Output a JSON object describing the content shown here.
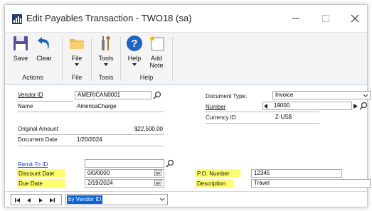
{
  "window": {
    "title": "Edit Payables Transaction  -  TWO18 (sa)"
  },
  "ribbon": {
    "groups": [
      {
        "label": "Actions",
        "buttons": [
          {
            "label": "Save",
            "icon": "save-icon"
          },
          {
            "label": "Clear",
            "icon": "undo-icon"
          }
        ]
      },
      {
        "label": "File",
        "buttons": [
          {
            "label": "File",
            "icon": "folder-icon"
          }
        ]
      },
      {
        "label": "Tools",
        "buttons": [
          {
            "label": "Tools",
            "icon": "tools-icon"
          }
        ]
      },
      {
        "label": "Help",
        "buttons": [
          {
            "label": "Help",
            "icon": "help-icon"
          },
          {
            "label": "Add",
            "label2": "Note",
            "icon": "note-icon"
          }
        ]
      }
    ]
  },
  "form": {
    "vendor_id": {
      "label": "Vendor ID",
      "value": "AMERICAN0001"
    },
    "name": {
      "label": "Name",
      "value": "AmericaCharge"
    },
    "original_amount": {
      "label": "Original Amount",
      "value": "$22,500.00"
    },
    "document_date": {
      "label": "Document Date",
      "value": "1/20/2024"
    },
    "remit_to_id": {
      "label": "Remit-To ID",
      "value": ""
    },
    "discount_date": {
      "label": "Discount Date",
      "value": "0/0/0000"
    },
    "due_date": {
      "label": "Due Date",
      "value": "2/19/2024"
    },
    "document_type": {
      "label": "Document Type:",
      "value": "Invoice"
    },
    "number": {
      "label": "Number",
      "value": "19000"
    },
    "currency_id": {
      "label": "Currency ID",
      "value": "Z-US$"
    },
    "po_number": {
      "label": "P.O. Number",
      "value": "12345"
    },
    "description": {
      "label": "Description",
      "value": "Travel"
    }
  },
  "statusbar": {
    "sort_by": "by Vendor ID"
  },
  "colors": {
    "highlight": "#ffff6e",
    "link": "#1d46b5",
    "selection": "#0a64d6",
    "save_icon": "#5b4f9a",
    "clear_icon": "#1565c0"
  }
}
